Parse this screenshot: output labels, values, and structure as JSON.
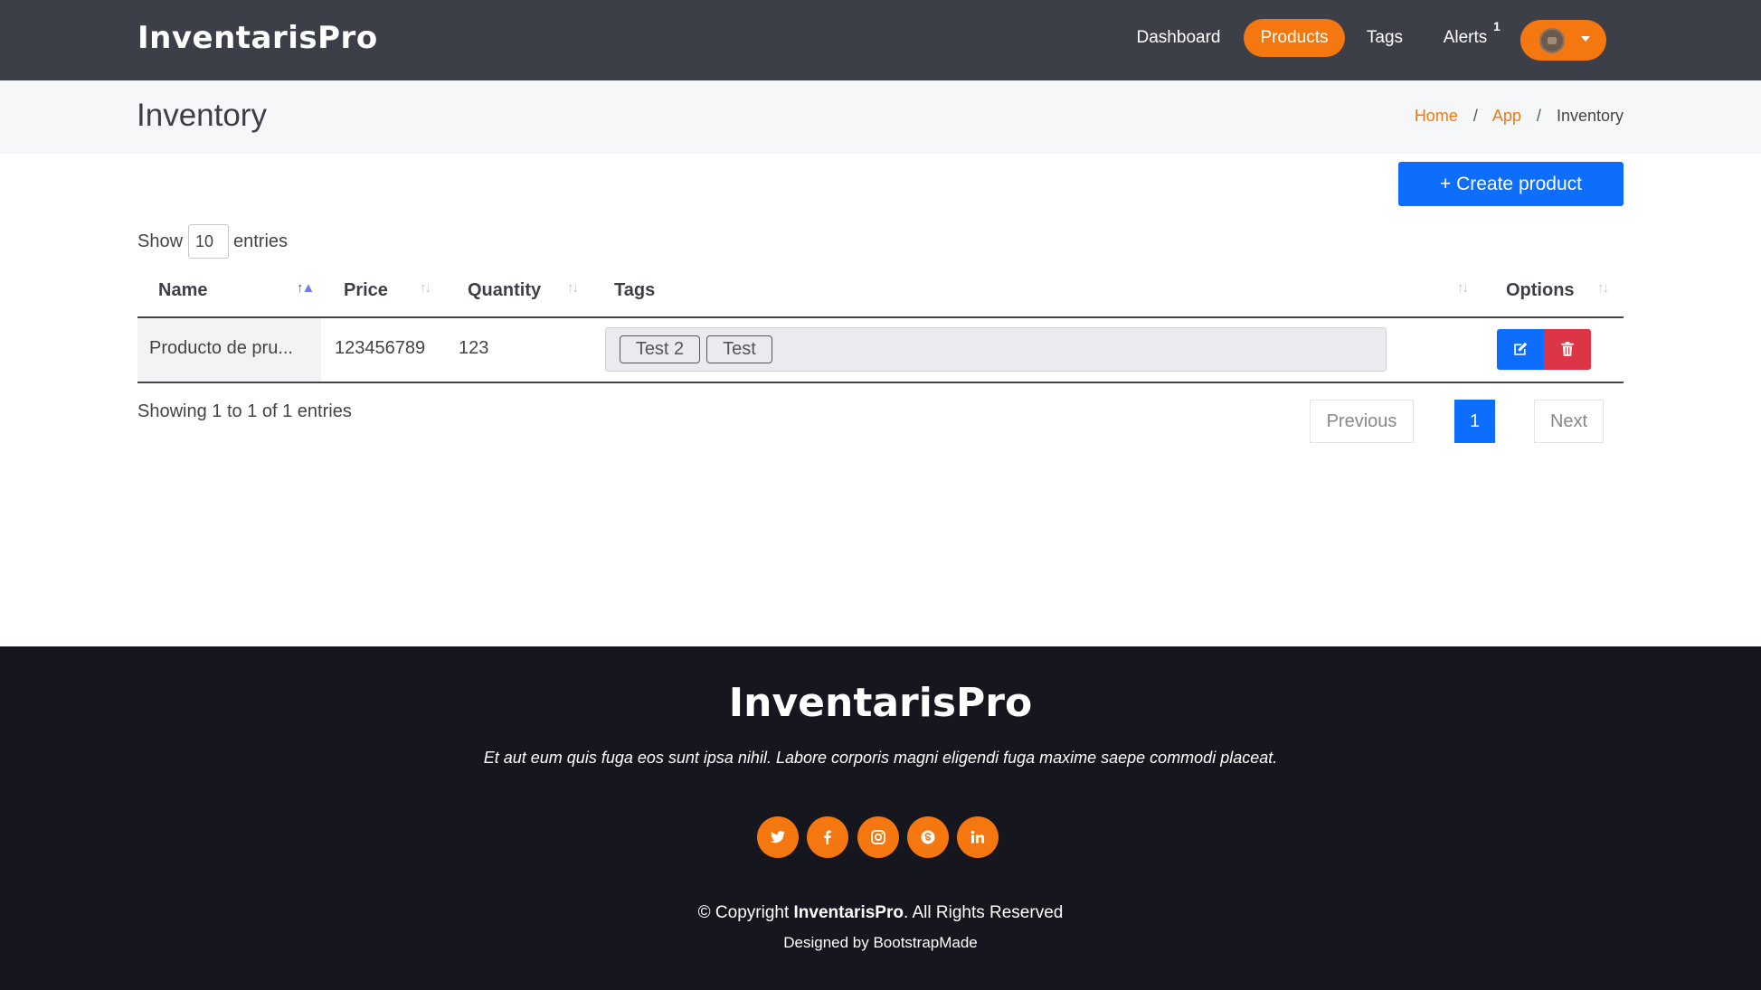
{
  "header": {
    "logo": "InventarisPro",
    "nav": {
      "dashboard": "Dashboard",
      "products": "Products",
      "tags": "Tags",
      "alerts": "Alerts",
      "alerts_badge": "1"
    },
    "accent_color": "#f5770f"
  },
  "page": {
    "title": "Inventory",
    "breadcrumb": [
      "Home",
      "App",
      "Inventory"
    ]
  },
  "toolbar": {
    "create_label": "+ Create product"
  },
  "length": {
    "show": "Show",
    "value": "10",
    "entries": "entries"
  },
  "table": {
    "columns": [
      "Name",
      "Price",
      "Quantity",
      "Tags",
      "Options"
    ],
    "rows": [
      {
        "name": "Producto de pru...",
        "price": "123456789",
        "quantity": "123",
        "tags": [
          "Test 2",
          "Test"
        ]
      }
    ]
  },
  "pagination": {
    "info": "Showing 1 to 1 of 1 entries",
    "previous": "Previous",
    "current": "1",
    "next": "Next"
  },
  "footer": {
    "logo": "InventarisPro",
    "tagline": "Et aut eum quis fuga eos sunt ipsa nihil. Labore corporis magni eligendi fuga maxime saepe commodi placeat.",
    "socials": [
      "twitter-icon",
      "facebook-icon",
      "instagram-icon",
      "skype-icon",
      "linkedin-icon"
    ],
    "copyright_prefix": "© Copyright ",
    "copyright_brand": "InventarisPro",
    "copyright_suffix": ". All Rights Reserved",
    "credits": "Designed by BootstrapMade"
  }
}
